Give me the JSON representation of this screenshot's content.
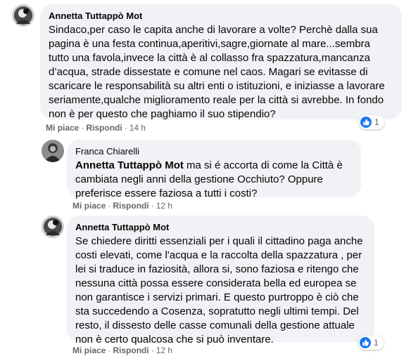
{
  "comments": [
    {
      "author": "Annetta Tuttappò Mot",
      "mention": "",
      "text": "Sindaco,per caso le capita anche di lavorare a volte? Perchè dalla sua pagina è una festa continua,aperitivi,sagre,giornate al mare...sembra tutto una favola,invece la città è al collasso fra spazzatura,mancanza d’acqua, strade dissestate e comune nel caos. Magari se evitasse di scaricare le responsabilità su altri enti o istituzioni, e iniziasse a lavorare seriamente,qualche miglioramento reale per la città si avrebbe. In fondo non è per questo che paghiamo il suo stipendio?",
      "like_label": "Mi piace",
      "reply_label": "Rispondi",
      "time": "14 h",
      "reaction_count": "1"
    },
    {
      "author": "Franca Chiarelli",
      "mention": "Annetta Tuttappò Mot",
      "text": " ma si é accorta di come la Città è cambiata negli anni della gestione Occhiuto? Oppure preferisce essere faziosa a tutti i costi?",
      "like_label": "Mi piace",
      "reply_label": "Rispondi",
      "time": "12 h",
      "reaction_count": ""
    },
    {
      "author": "Annetta Tuttappò Mot",
      "mention": "",
      "text": "Se chiedere diritti essenziali per i quali il cittadino paga anche costi elevati, come l'acqua e la raccolta della spazzatura , per lei si traduce in faziosità, allora si, sono faziosa e ritengo che nessuna città possa essere considerata bella ed europea se non garantisce i servizi primari. E questo purtroppo è ciò che sta succedendo a Cosenza, sopratutto negli ultimi tempi. Del resto, il dissesto delle casse comunali della gestione attuale non è certo qualcosa che si può inventare.",
      "like_label": "Mi piace",
      "reply_label": "Rispondi",
      "time": "12 h",
      "reaction_count": "1"
    }
  ],
  "separator": "·",
  "colors": {
    "bubble": "#f0f2f5",
    "text": "#050505",
    "secondary": "#65676b",
    "like_blue": "#1877f2"
  },
  "icons": {
    "avatar": "profile-photo",
    "reaction": "thumbs-up-icon"
  }
}
